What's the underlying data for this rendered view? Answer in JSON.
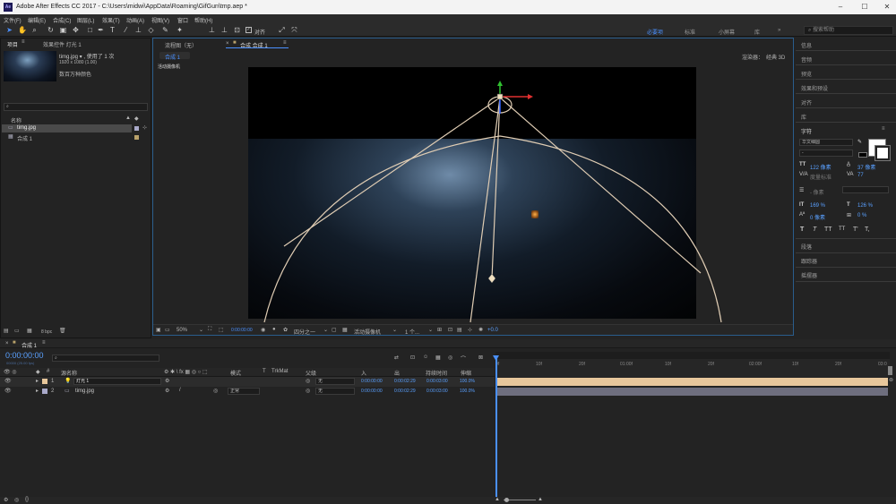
{
  "titlebar": {
    "title": "Adobe After Effects CC 2017 - C:\\Users\\midwi\\AppData\\Roaming\\GifGun\\tmp.aep *",
    "logo": "Ae"
  },
  "menu": [
    "文件(F)",
    "编辑(E)",
    "合成(C)",
    "图层(L)",
    "效果(T)",
    "动画(A)",
    "视图(V)",
    "窗口",
    "帮助(H)"
  ],
  "toolbar": {
    "snap_label": "对齐",
    "workspaces": [
      "必要项",
      "标准",
      "小屏幕",
      "库"
    ],
    "search_placeholder": "搜索帮助"
  },
  "project": {
    "tab_project": "项目",
    "tab_effects": "效果控件 灯光 1",
    "thumb_name": "timg.jpg ▾ , 使用了 1 次",
    "thumb_dims": "1920 x 1080 (1.00)",
    "thumb_color": "数百万种颜色",
    "col_name": "名称",
    "items": [
      "timg.jpg",
      "合成 1"
    ],
    "bpc": "8 bpc"
  },
  "viewer": {
    "tab_flow": "流程图（无）",
    "tab_comp": "合成 合成 1",
    "comp_chip": "合成 1",
    "camera_label": "活动摄像机",
    "renderer_label": "渲染器：",
    "renderer_value": "经典 3D",
    "zoom": "50%",
    "timecode": "0:00:00:00",
    "quarter": "四分之一",
    "active_camera": "活动摄像机",
    "views": "1 个...",
    "exposure": "+0.0"
  },
  "right_panel": {
    "items": [
      "信息",
      "音频",
      "预览",
      "效果和预设",
      "对齐",
      "库"
    ],
    "char_title": "字符",
    "font": "华文细圆",
    "font_style": "-",
    "size": "122 像素",
    "leading": "37 像素",
    "kerning": "度量标准",
    "tracking": "77",
    "stroke": "- 像素",
    "vscale": "169 %",
    "hscale": "126 %",
    "baseline": "0 像素",
    "tsume": "0 %",
    "style_buttons": [
      "T",
      "T",
      "TT",
      "TT",
      "T'",
      "T,"
    ],
    "bottom": [
      "段落",
      "跟踪器",
      "摇摆器"
    ]
  },
  "timeline": {
    "tab": "合成 1",
    "timecode": "0:00:00:00",
    "fps": "00000 (25.00 fps)",
    "headers": {
      "name": "源名称",
      "mode": "模式",
      "t": "T",
      "trkmat": "TrkMat",
      "parent": "父级",
      "in": "入",
      "out": "出",
      "duration": "持续时间",
      "stretch": "伸缩"
    },
    "layers": [
      {
        "num": "1",
        "name": "灯光 1",
        "mode": "",
        "parent": "无",
        "in": "0:00:00:00",
        "out": "0:00:02:29",
        "duration": "0:00:03:00",
        "stretch": "100.0%",
        "color": "#e8c79c"
      },
      {
        "num": "2",
        "name": "timg.jpg",
        "mode": "正常",
        "parent": "无",
        "in": "0:00:00:00",
        "out": "0:00:02:29",
        "duration": "0:00:03:00",
        "stretch": "100.0%",
        "color": "#a9a9c9"
      }
    ],
    "ruler": [
      "0f",
      "10f",
      "20f",
      "01:00f",
      "10f",
      "20f",
      "02:00f",
      "10f",
      "20f",
      "03:0"
    ]
  }
}
